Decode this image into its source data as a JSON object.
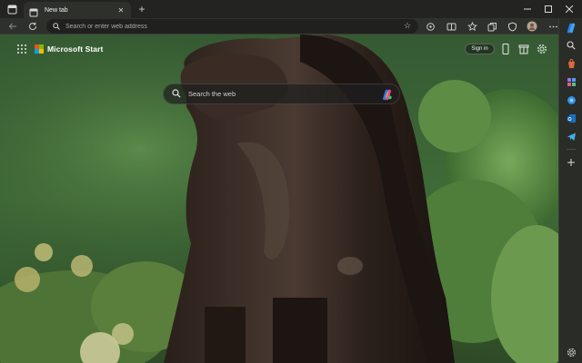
{
  "tabs": [
    {
      "title": "New tab"
    }
  ],
  "address_bar": {
    "placeholder": "Search or enter web address",
    "value": ""
  },
  "start_page": {
    "brand": "Microsoft Start",
    "sign_in_label": "Sign in",
    "search_placeholder": "Search the web"
  },
  "icons": {
    "tab_actions": "tab-actions-icon",
    "tab_page": "page-icon",
    "tab_close": "close-icon",
    "new_tab": "plus-icon",
    "back": "back-arrow-icon",
    "refresh": "refresh-icon",
    "search": "search-icon",
    "favorite": "star-icon",
    "toolbar": [
      "refresh-icon",
      "split-screen-icon",
      "favorites-icon",
      "collections-icon",
      "browser-essentials-icon",
      "profile-icon",
      "more-icon",
      "copilot-icon"
    ],
    "sidebar": [
      "search-icon",
      "shopping-icon",
      "tools-icon",
      "outlook-icon",
      "edge-drop-icon",
      "telegram-icon",
      "add-icon",
      "settings-icon"
    ]
  },
  "colors": {
    "accent": "#2b7de9",
    "chrome_dark": "#2e302b",
    "tab_bar": "#232421"
  }
}
